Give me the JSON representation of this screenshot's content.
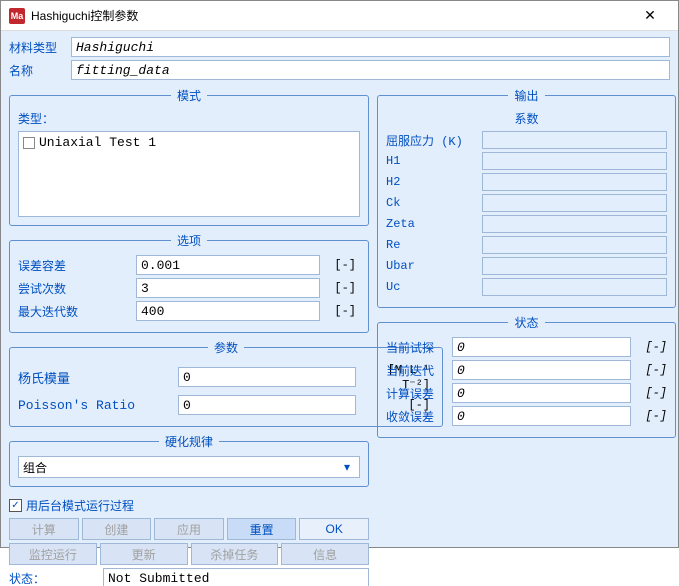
{
  "title": "Hashiguchi控制参数",
  "icon_text": "Ma",
  "header": {
    "material_type_label": "材料类型",
    "material_type_value": "Hashiguchi",
    "name_label": "名称",
    "name_value": "fitting_data"
  },
  "mode": {
    "legend": "模式",
    "type_label": "类型：",
    "items": [
      "Uniaxial Test 1"
    ]
  },
  "options": {
    "legend": "选项",
    "rows": [
      {
        "label": "误差容差",
        "value": "0.001",
        "unit": "[-]"
      },
      {
        "label": "尝试次数",
        "value": "3",
        "unit": "[-]"
      },
      {
        "label": "最大迭代数",
        "value": "400",
        "unit": "[-]"
      }
    ]
  },
  "params": {
    "legend": "参数",
    "rows": [
      {
        "label": "杨氏模量",
        "value": "0",
        "unit_html": "[M L⁻¹ T⁻²]"
      },
      {
        "label": "Poisson's Ratio",
        "value": "0",
        "unit_html": "[-]"
      }
    ]
  },
  "harden": {
    "legend": "硬化规律",
    "selected": "组合"
  },
  "output": {
    "legend": "输出",
    "sublegend": "系数",
    "rows": [
      {
        "label": "屈服应力 (K)"
      },
      {
        "label": "H1"
      },
      {
        "label": "H2"
      },
      {
        "label": "Ck"
      },
      {
        "label": "Zeta"
      },
      {
        "label": "Re"
      },
      {
        "label": "Ubar"
      },
      {
        "label": "Uc"
      }
    ]
  },
  "status_panel": {
    "legend": "状态",
    "rows": [
      {
        "label": "当前试探",
        "value": "0",
        "unit": "[-]"
      },
      {
        "label": "当前迭代",
        "value": "0",
        "unit": "[-]"
      },
      {
        "label": "计算误差",
        "value": "0",
        "unit": "[-]"
      },
      {
        "label": "收敛误差",
        "value": "0",
        "unit": "[-]"
      }
    ]
  },
  "bottom": {
    "checkbox_label": "用后台模式运行过程",
    "checkbox_checked": true,
    "row1": [
      {
        "label": "计算",
        "state": "disabled"
      },
      {
        "label": "创建",
        "state": "disabled"
      },
      {
        "label": "应用",
        "state": "disabled"
      },
      {
        "label": "重置",
        "state": "primary"
      },
      {
        "label": "OK",
        "state": "enabled"
      }
    ],
    "row2": [
      {
        "label": "监控运行",
        "state": "disabled"
      },
      {
        "label": "更新",
        "state": "disabled"
      },
      {
        "label": "杀掉任务",
        "state": "disabled"
      },
      {
        "label": "信息",
        "state": "disabled"
      }
    ],
    "status_label": "状态：",
    "status_value": "Not Submitted"
  }
}
